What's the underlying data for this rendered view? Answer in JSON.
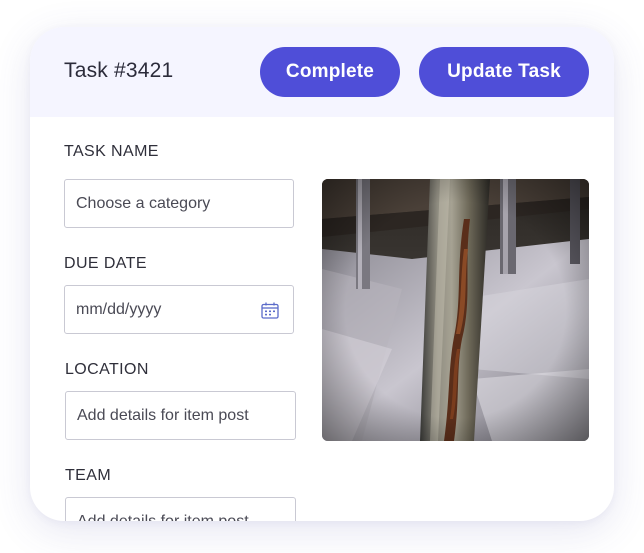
{
  "header": {
    "task_title": "Task #3421",
    "complete_label": "Complete",
    "update_label": "Update Task"
  },
  "form": {
    "task_name": {
      "label": "TASK NAME",
      "placeholder": "Choose a category"
    },
    "due_date": {
      "label": "DUE DATE",
      "placeholder": "mm/dd/yyyy"
    },
    "location": {
      "label": "LOCATION",
      "placeholder": "Add details for item post"
    },
    "team": {
      "label": "TEAM",
      "placeholder": "Add details for item post"
    }
  },
  "colors": {
    "accent": "#4f4ed8",
    "header_bg": "#f5f5ff"
  },
  "icons": {
    "date": "calendar-icon"
  }
}
